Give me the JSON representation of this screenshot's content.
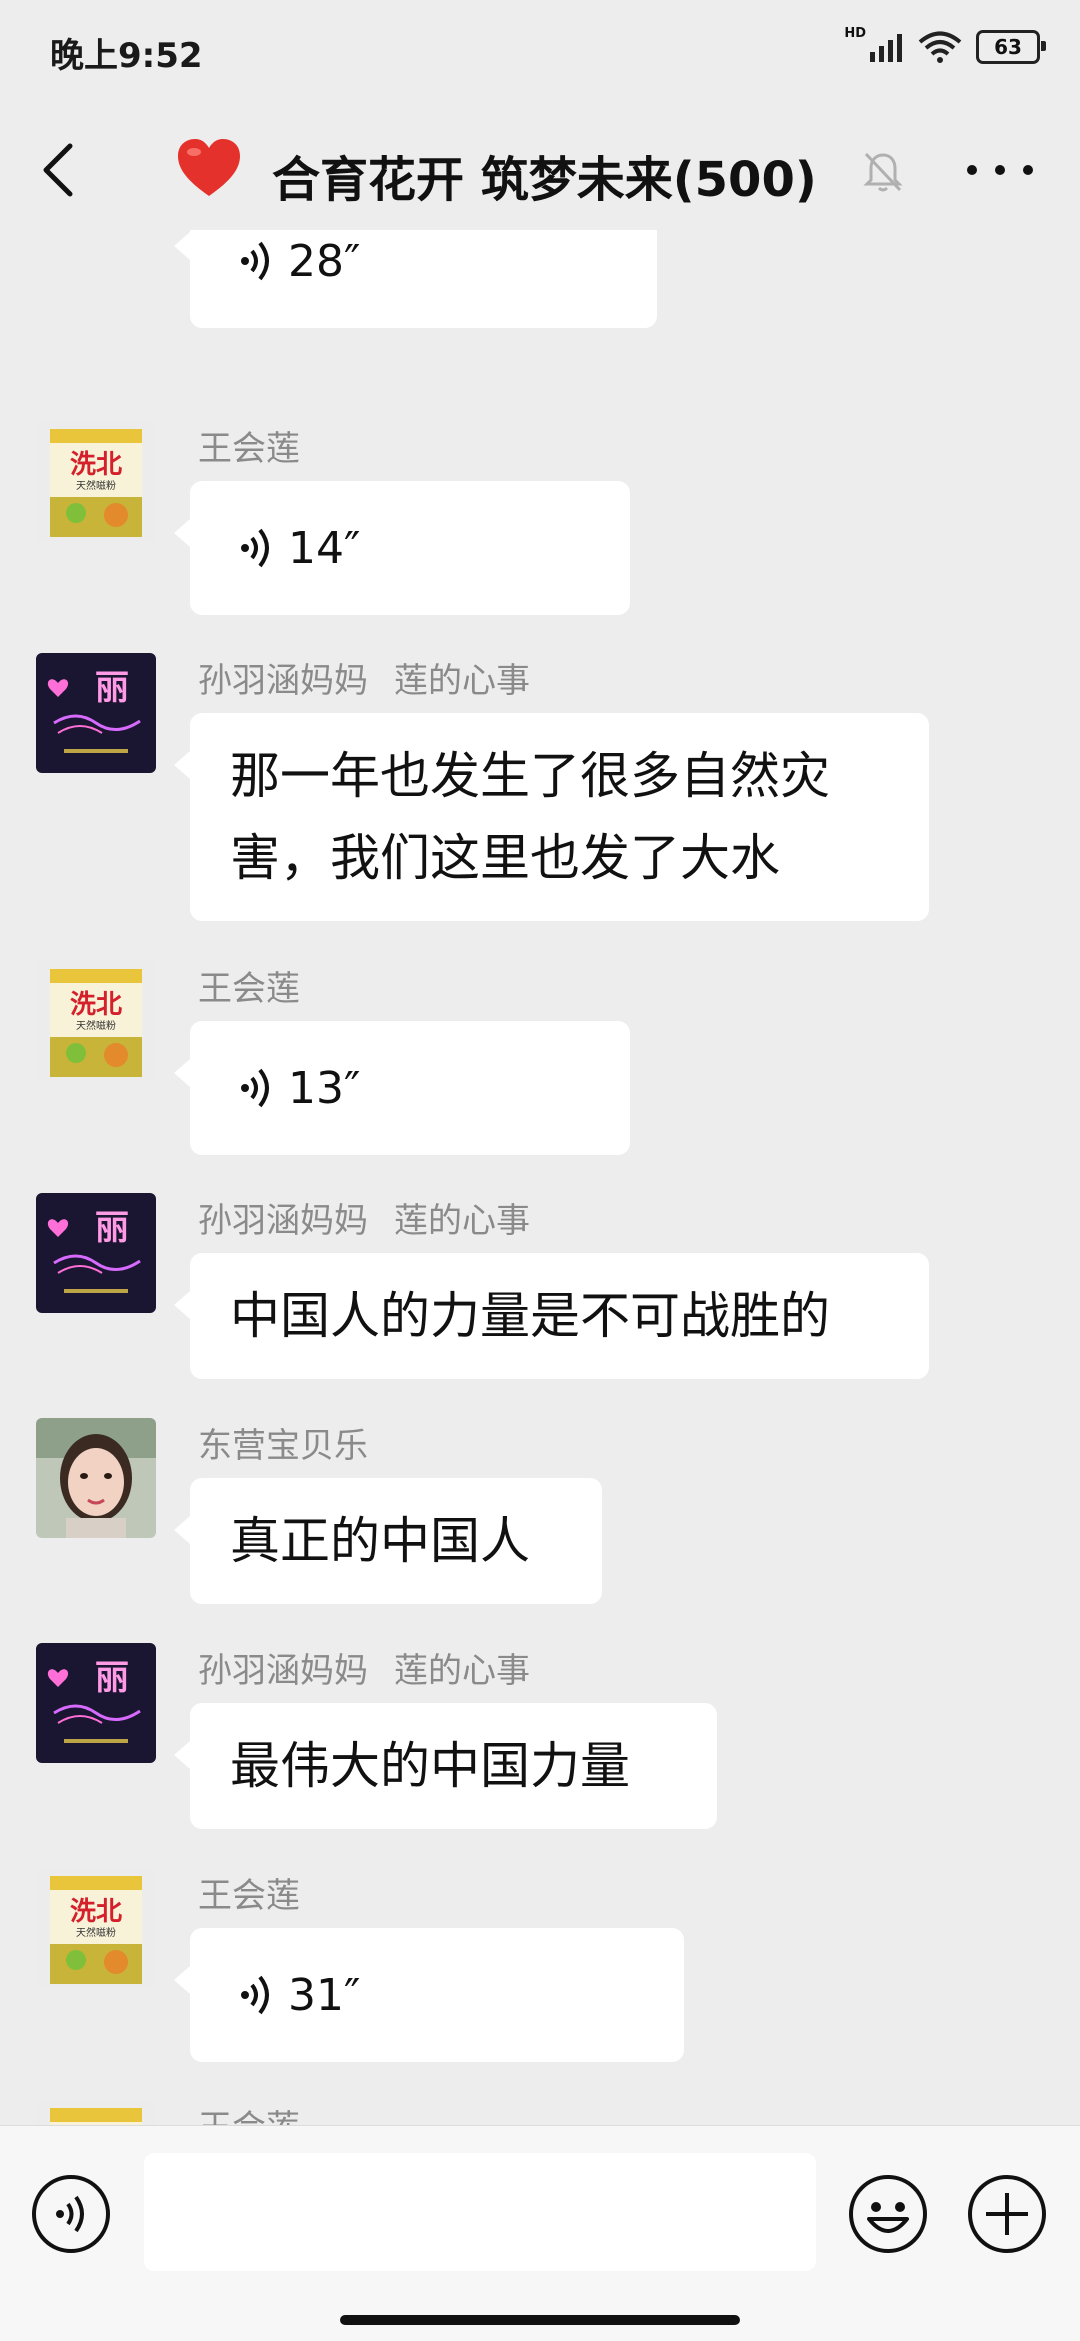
{
  "status": {
    "time": "晚上9:52",
    "hd": "HD",
    "battery": "63"
  },
  "header": {
    "title": "合育花开 筑梦未来(500)"
  },
  "messages": [
    {
      "sender": "",
      "type": "voice",
      "duration": "28″",
      "avatar": "flour-bag-avatar"
    },
    {
      "sender": "王会莲",
      "type": "voice",
      "duration": "14″",
      "avatar": "flour-bag-avatar"
    },
    {
      "sender": "孙羽涵妈妈",
      "remark": "莲的心事",
      "type": "text",
      "lines": [
        "那一年也发生了很多自然灾",
        "害，我们这里也发了大水"
      ],
      "avatar": "neon-li-avatar"
    },
    {
      "sender": "王会莲",
      "type": "voice",
      "duration": "13″",
      "avatar": "flour-bag-avatar"
    },
    {
      "sender": "孙羽涵妈妈",
      "remark": "莲的心事",
      "type": "text",
      "lines": [
        "中国人的力量是不可战胜的"
      ],
      "avatar": "neon-li-avatar"
    },
    {
      "sender": "东营宝贝乐",
      "type": "text",
      "lines": [
        "真正的中国人"
      ],
      "avatar": "portrait-avatar"
    },
    {
      "sender": "孙羽涵妈妈",
      "remark": "莲的心事",
      "type": "text",
      "lines": [
        "最伟大的中国力量"
      ],
      "avatar": "neon-li-avatar"
    },
    {
      "sender": "王会莲",
      "type": "voice",
      "duration": "31″",
      "avatar": "flour-bag-avatar"
    },
    {
      "sender": "王会莲",
      "type": "partial",
      "avatar": "flour-bag-avatar"
    }
  ],
  "avatar_art": {
    "flour_brand": "洗北",
    "flour_sub": "天然嗞粉",
    "neon_char": "丽"
  },
  "colors": {
    "background": "#ededed",
    "bubble": "#ffffff",
    "name": "#8a8a8a",
    "heart": "#e5312b"
  }
}
